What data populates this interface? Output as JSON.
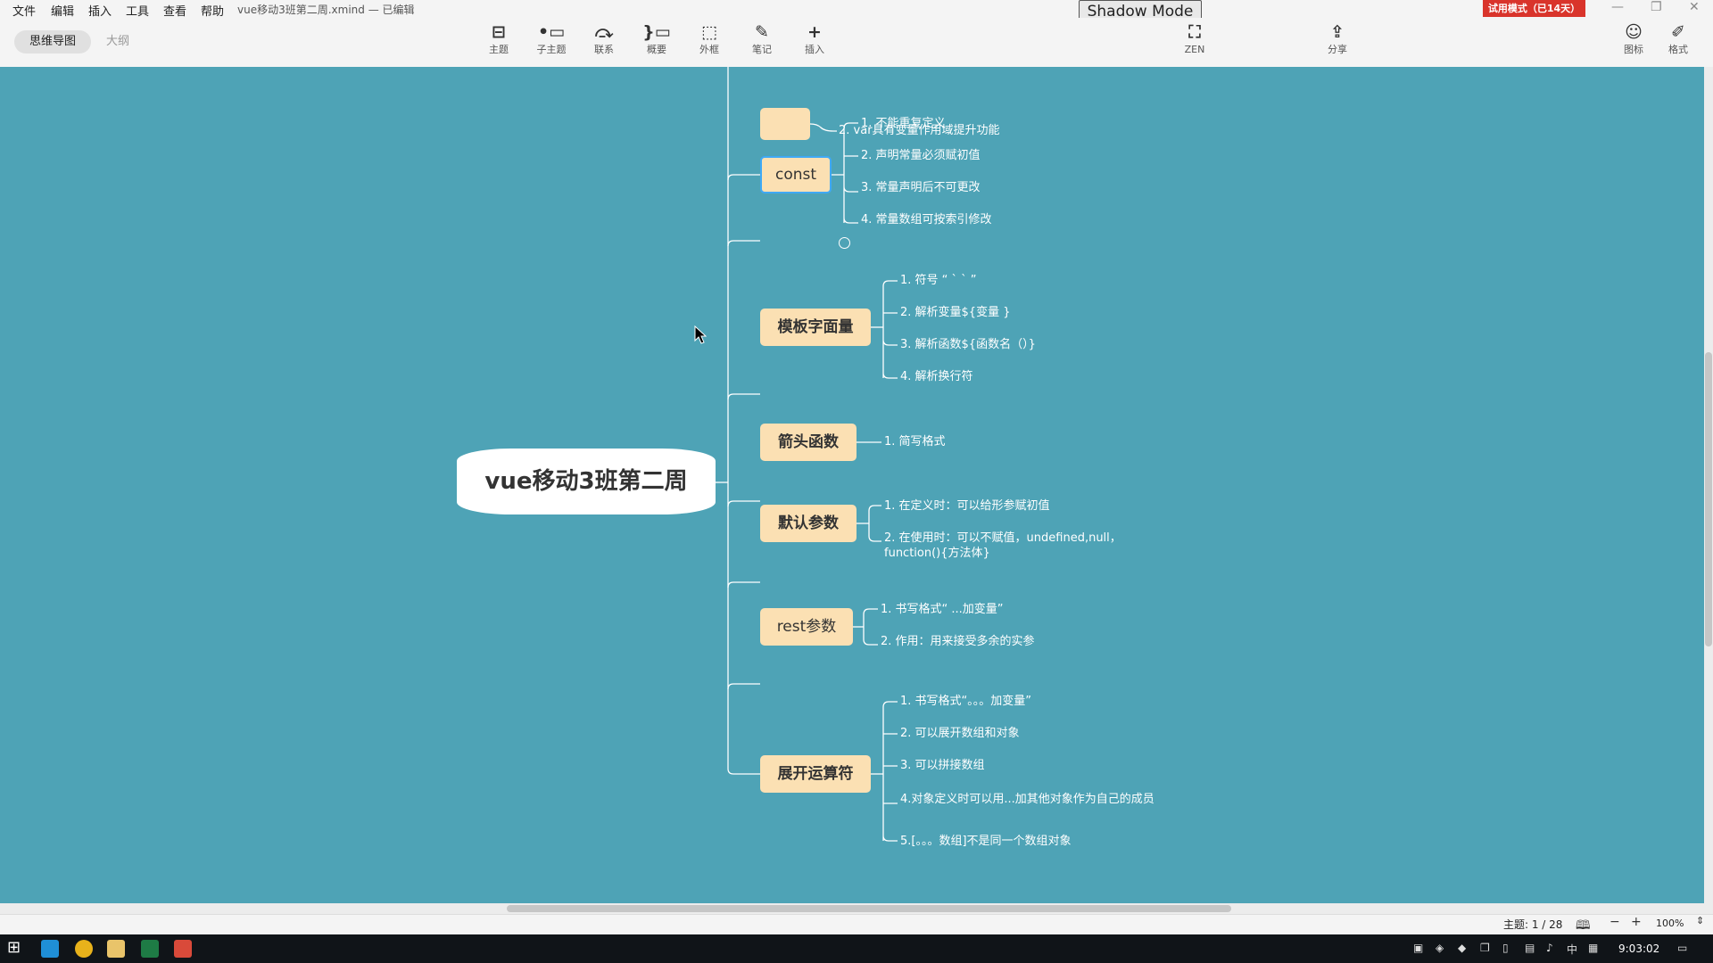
{
  "menubar": {
    "items": [
      "文件",
      "编辑",
      "插入",
      "工具",
      "查看",
      "帮助"
    ],
    "doc_title": "vue移动3班第二周.xmind — 已编辑",
    "shadow_mode": "Shadow Mode",
    "trial_badge": "试用模式（已14天）"
  },
  "view_tabs": [
    "思维导图",
    "大纲"
  ],
  "toolbar": {
    "tools": [
      {
        "label": "主题",
        "icon": "topic-icon"
      },
      {
        "label": "子主题",
        "icon": "subtopic-icon"
      },
      {
        "label": "联系",
        "icon": "relationship-icon"
      },
      {
        "label": "概要",
        "icon": "summary-icon"
      },
      {
        "label": "外框",
        "icon": "boundary-icon"
      },
      {
        "label": "笔记",
        "icon": "note-icon"
      },
      {
        "label": "插入",
        "icon": "plus-icon"
      }
    ],
    "zen": "ZEN",
    "share": "分享",
    "icons_label": "图标",
    "format_label": "格式"
  },
  "mindmap": {
    "central": "vue移动3班第二周",
    "partial_subtopic": "2. var具有变量作用域提升功能",
    "branches": [
      {
        "label": "const",
        "children": [
          "1. 不能重复定义",
          "2. 声明常量必须赋初值",
          "3. 常量声明后不可更改",
          "4. 常量数组可按索引修改"
        ]
      },
      {
        "label": "模板字面量",
        "children": [
          "1. 符号 “ ` ` ”",
          "2. 解析变量${变量 }",
          "3. 解析函数${函数名（）}",
          "4. 解析换行符"
        ]
      },
      {
        "label": "箭头函数",
        "children": [
          "1. 简写格式"
        ]
      },
      {
        "label": "默认参数",
        "children": [
          "1. 在定义时：可以给形参赋初值",
          "2. 在使用时：可以不赋值，undefined,null，function(){方法体}"
        ]
      },
      {
        "label": "rest参数",
        "children": [
          "1. 书写格式“ ...加变量”",
          "2. 作用：用来接受多余的实参"
        ]
      },
      {
        "label": "展开运算符",
        "children": [
          "1. 书写格式“。。。加变量”",
          "2. 可以展开数组和对象",
          "3. 可以拼接数组",
          "4.对象定义时可以用...加其他对象作为自己的成员",
          "5.[。。。数组]不是同一个数组对象"
        ]
      }
    ]
  },
  "statusbar": {
    "topic_count": "主题: 1 / 28",
    "zoom": "100%"
  },
  "taskbar": {
    "time": "9:03:02",
    "ime": "中"
  },
  "colors": {
    "canvas": "#4ea3b6",
    "topic_fill": "#fbe0b3",
    "selection": "#3fa9f5",
    "trial": "#d9342b"
  }
}
